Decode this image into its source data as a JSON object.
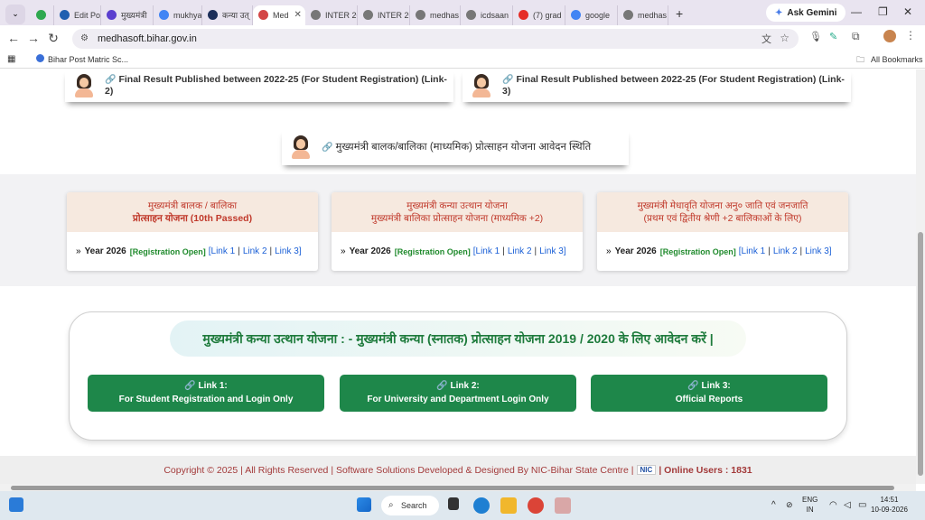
{
  "browser": {
    "tabs": [
      {
        "label": "",
        "icon": "extension-icon",
        "color": "#2fa84f"
      },
      {
        "label": "Edit Post",
        "icon": "blog-icon",
        "color": "#1f5fb0"
      },
      {
        "label": "मुख्यमंत्री",
        "icon": "site-icon",
        "color": "#5b3fcf"
      },
      {
        "label": "mukhya",
        "icon": "google-icon",
        "color": "#4285f4"
      },
      {
        "label": "कन्या उत्",
        "icon": "site-icon",
        "color": "#1d2f5a"
      },
      {
        "label": "Med",
        "icon": "bihar-icon",
        "color": "#d34646",
        "active": true
      },
      {
        "label": "INTER 20",
        "icon": "globe-icon",
        "color": "#777"
      },
      {
        "label": "INTER 20",
        "icon": "globe-icon",
        "color": "#777"
      },
      {
        "label": "medhas",
        "icon": "globe-icon",
        "color": "#777"
      },
      {
        "label": "icdsaan",
        "icon": "globe-icon",
        "color": "#777"
      },
      {
        "label": "(7) grad",
        "icon": "youtube-icon",
        "color": "#e52d27"
      },
      {
        "label": "google",
        "icon": "google-icon",
        "color": "#4285f4"
      },
      {
        "label": "medhas",
        "icon": "globe-icon",
        "color": "#777"
      }
    ],
    "new_tab": "+",
    "ask_gemini": "Ask Gemini",
    "url": "medhasoft.bihar.gov.in",
    "bookmark": "Bihar Post Matric Sc...",
    "all_bookmarks": "All Bookmarks"
  },
  "results": {
    "link2": "Final Result Published between 2022-25 (For Student Registration) (Link-2)",
    "link3": "Final Result Published between 2022-25 (For Student Registration) (Link-3)",
    "status": "मुख्यमंत्री बालक/बालिका (माध्यमिक) प्रोत्साहन योजना आवेदन स्थिति"
  },
  "schemes": [
    {
      "title1": "मुख्यमंत्री बालक / बालिका",
      "title2": "प्रोत्साहन योजना (10th Passed)",
      "year": "Year 2026",
      "reg": "[Registration Open]",
      "l1": "[Link 1",
      "l2": "Link 2",
      "l3": "Link 3]"
    },
    {
      "title1": "मुख्यमंत्री कन्या उत्थान योजना",
      "title2": "मुख्यमंत्री बालिका प्रोत्साहन योजना (माध्यमिक +2)",
      "year": "Year 2026",
      "reg": "[Registration Open]",
      "l1": "[Link 1",
      "l2": "Link 2",
      "l3": "Link 3]"
    },
    {
      "title1": "मुख्यमंत्री मेधावृति योजना अनु० जाति एवं जनजाति",
      "title2": "(प्रथम एवं द्वितीय श्रेणी +2 बालिकाओं के लिए)",
      "year": "Year 2026",
      "reg": "[Registration Open]",
      "l1": "[Link 1",
      "l2": "Link 2",
      "l3": "Link 3]"
    }
  ],
  "kanya": {
    "title": "मुख्यमंत्री कन्या उत्थान योजना : - मुख्यमंत्री कन्या (स्नातक) प्रोत्साहन योजना 2019 / 2020 के लिए आवेदन करें |",
    "buttons": [
      {
        "head": "Link 1:",
        "sub": "For Student Registration and Login Only"
      },
      {
        "head": "Link 2:",
        "sub": "For University and Department Login Only"
      },
      {
        "head": "Link 3:",
        "sub": "Official Reports"
      }
    ]
  },
  "footer": {
    "text": "Copyright © 2025 | All Rights Reserved | Software Solutions Developed & Designed By NIC-Bihar State Centre |",
    "nic": "NIC",
    "online": "| Online Users : 1831"
  },
  "taskbar": {
    "search": "Search",
    "lang1": "ENG",
    "lang2": "IN",
    "time": "14:51",
    "date": "10-09-2026"
  }
}
